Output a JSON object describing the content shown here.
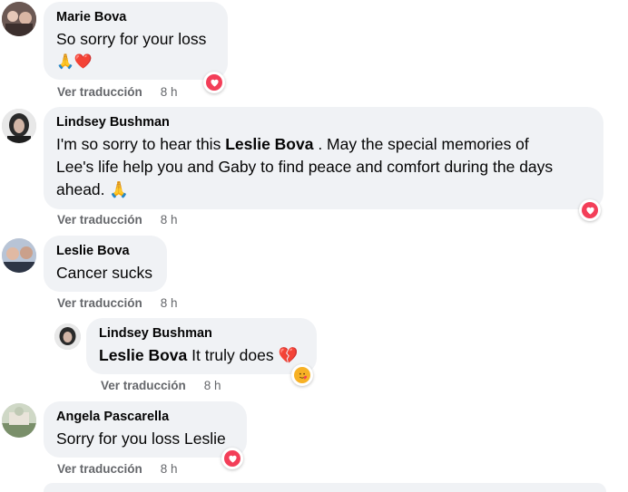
{
  "comments": [
    {
      "author": "Marie Bova",
      "text": "So sorry for your loss",
      "emoji_line": "🙏❤️",
      "action": "Ver traducción",
      "time": "8 h",
      "reaction_icon": "love-heart"
    },
    {
      "author": "Lindsey Bushman",
      "text_before": "I'm so sorry to hear this ",
      "mention": "Leslie Bova",
      "text_after": " . May the special memories of",
      "line2": "Lee's life help you and Gaby to find peace and comfort during the days",
      "line3": "ahead. 🙏",
      "action": "Ver traducción",
      "time": "8 h",
      "reaction_icon": "love-heart"
    },
    {
      "author": "Leslie Bova",
      "text": "Cancer sucks",
      "action": "Ver traducción",
      "time": "8 h"
    },
    {
      "author": "Lindsey Bushman",
      "mention": "Leslie Bova",
      "text": " It truly does 💔",
      "action": "Ver traducción",
      "time": "8 h",
      "reaction_icon": "care-hug"
    },
    {
      "author": "Angela Pascarella",
      "text": "Sorry for you loss Leslie",
      "action": "Ver traducción",
      "time": "8 h",
      "reaction_icon": "love-heart"
    }
  ],
  "colors": {
    "bubble": "#f0f2f5",
    "meta_text": "#65676b",
    "love": "#f33e58",
    "care": "#f7b125"
  }
}
